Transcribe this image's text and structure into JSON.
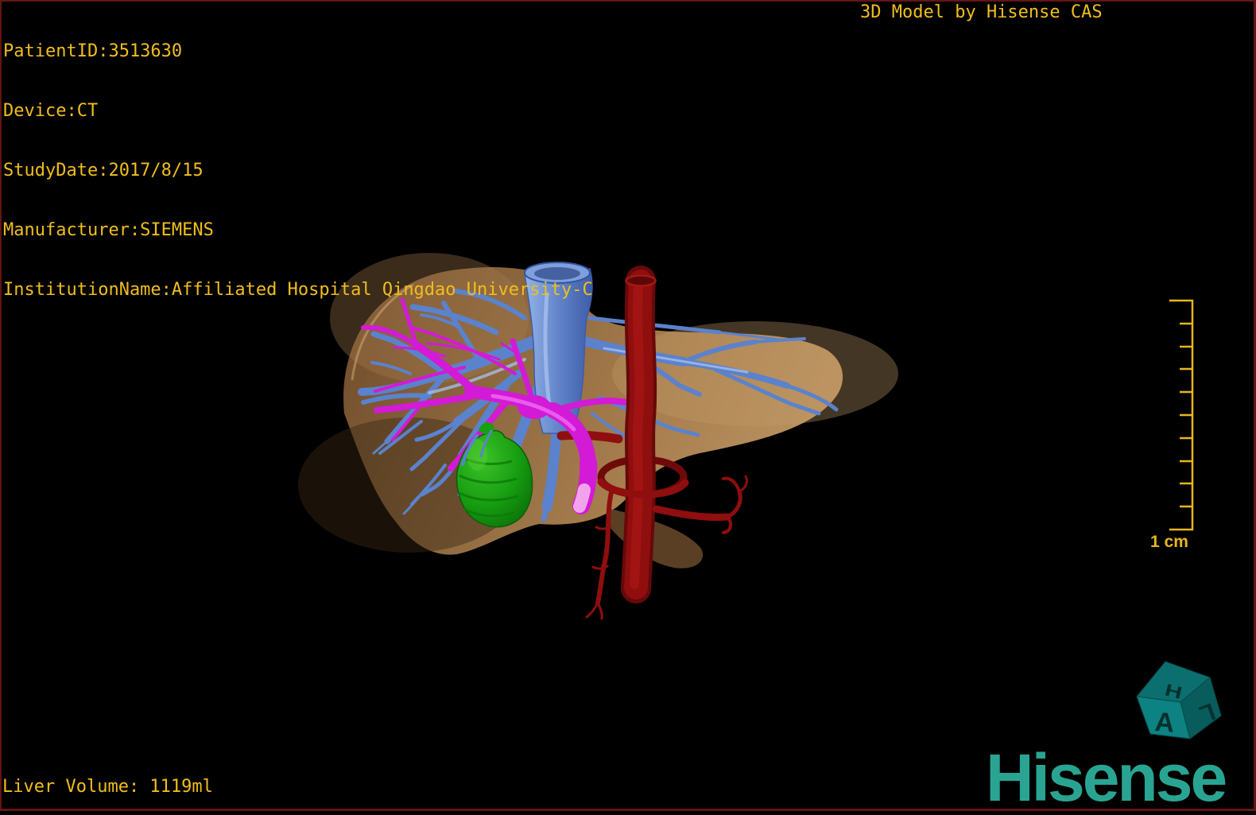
{
  "header": {
    "patient_info": [
      "PatientID:3513630",
      "Device:CT",
      "StudyDate:2017/8/15",
      "Manufacturer:SIEMENS",
      "InstitutionName:Affiliated Hospital Qingdao University-C"
    ],
    "watermark": "3D Model by Hisense CAS"
  },
  "footer": {
    "liver_volume": "Liver Volume: 1119ml"
  },
  "scale_bar": {
    "label": "1 cm",
    "units_shown": 10
  },
  "orientation_cube": {
    "top_letter": "H",
    "front_letter": "A",
    "right_letter": "L"
  },
  "branding": {
    "logo_text": "Hisense"
  },
  "model": {
    "organs": [
      {
        "name": "liver",
        "color": "#9a7248"
      },
      {
        "name": "hepatic-vein-ivc",
        "color": "#5b82cc"
      },
      {
        "name": "portal-vein",
        "color": "#d31ad6"
      },
      {
        "name": "aorta-hepatic-artery",
        "color": "#8f0e0e"
      },
      {
        "name": "gallbladder",
        "color": "#159b10"
      }
    ]
  },
  "colors": {
    "annotation_text": "#f0be1e",
    "logo_teal": "#2aa492",
    "cube_teal": "#0a7070",
    "frame_border": "#641515",
    "background": "#000000"
  }
}
